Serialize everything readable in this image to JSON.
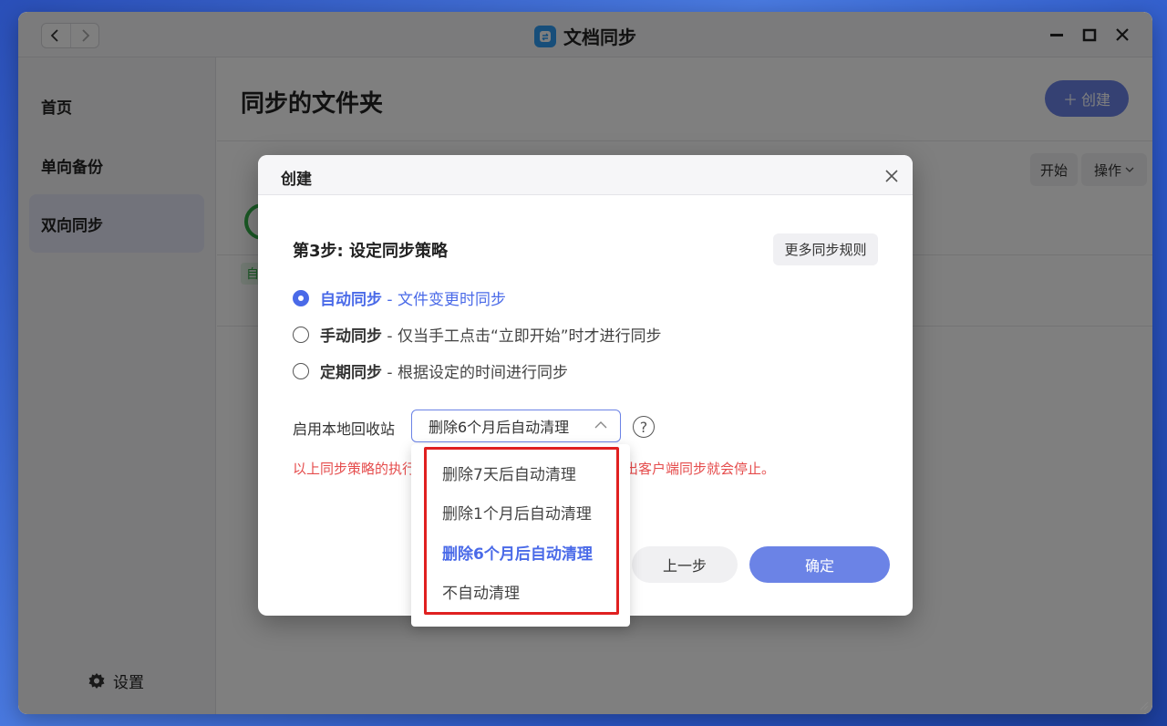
{
  "window": {
    "title": "文档同步",
    "nav": {
      "back_icon": "chevron-left-icon",
      "forward_icon": "chevron-right-icon"
    },
    "controls": [
      "minimize-icon",
      "maximize-icon",
      "close-icon"
    ]
  },
  "sidebar": {
    "items": [
      {
        "label": "首页",
        "active": false
      },
      {
        "label": "单向备份",
        "active": false
      },
      {
        "label": "双向同步",
        "active": true
      }
    ],
    "settings_label": "设置"
  },
  "main": {
    "title": "同步的文件夹",
    "create_label": "创建",
    "start_label": "开始",
    "ops_label": "操作",
    "status_tag": "自"
  },
  "dialog": {
    "title": "创建",
    "step_title": "第3步: 设定同步策略",
    "more_rules_label": "更多同步规则",
    "options": [
      {
        "name": "自动同步",
        "desc": "- 文件变更时同步",
        "checked": true
      },
      {
        "name": "手动同步",
        "desc": "- 仅当手工点击“立即开始”时才进行同步",
        "checked": false
      },
      {
        "name": "定期同步",
        "desc": "- 根据设定的时间进行同步",
        "checked": false
      }
    ],
    "recycle_label": "启用本地回收站",
    "recycle_value": "删除6个月后自动清理",
    "help_glyph": "?",
    "warning_left": "以上同步策略的执行",
    "warning_right": "出客户端同步就会停止。",
    "prev_label": "上一步",
    "ok_label": "确定"
  },
  "dropdown": {
    "options": [
      "删除7天后自动清理",
      "删除1个月后自动清理",
      "删除6个月后自动清理",
      "不自动清理"
    ],
    "selected_index": 2
  },
  "colors": {
    "accent": "#6b83e6",
    "selected_text": "#4a6ae8",
    "warning": "#e54c4c",
    "highlight_frame": "#e02020",
    "success": "#35b24a"
  }
}
